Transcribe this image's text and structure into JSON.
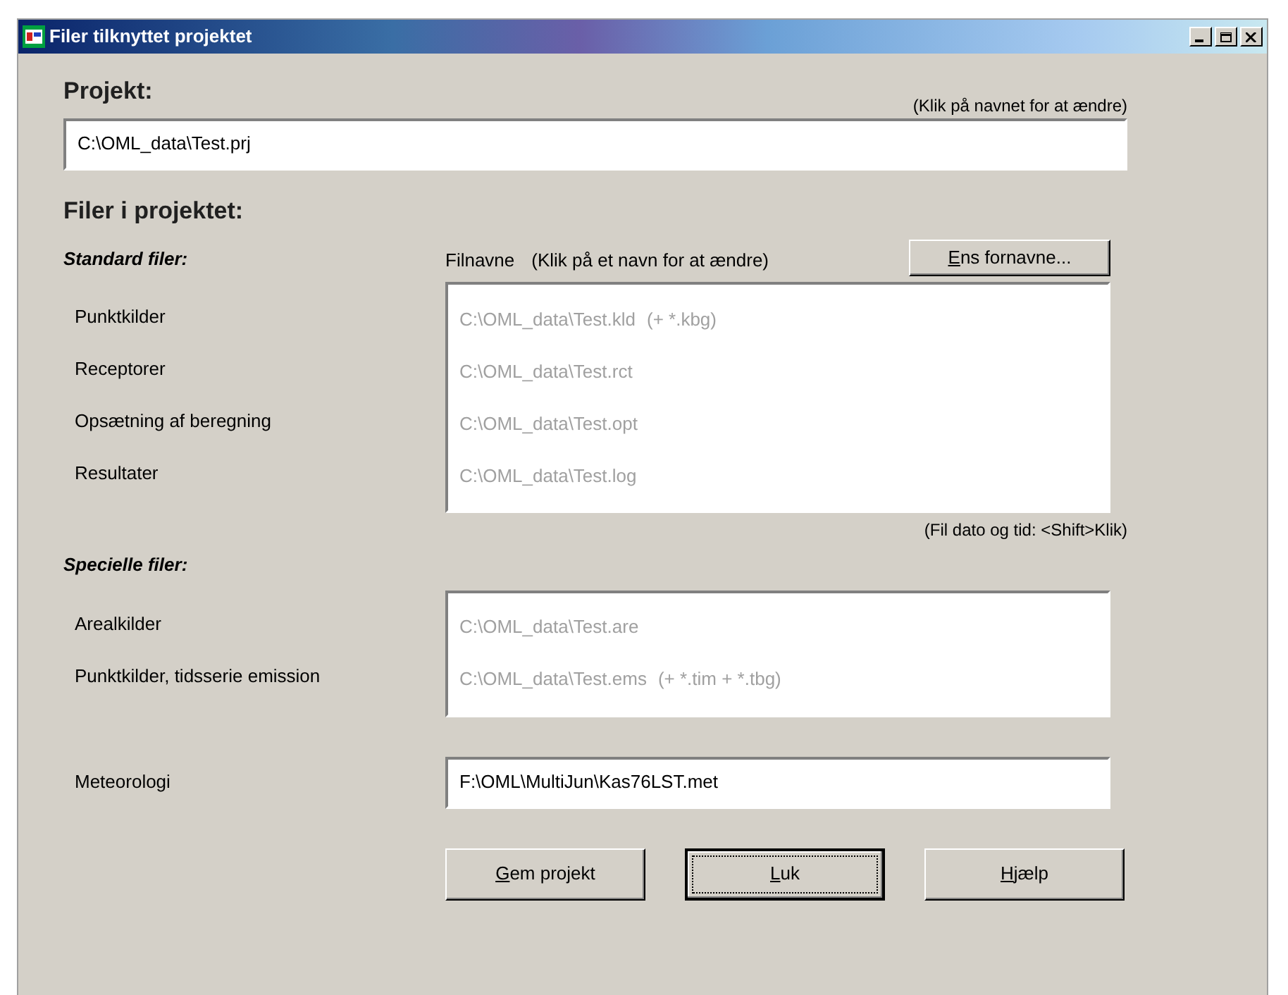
{
  "window": {
    "title": "Filer tilknyttet projektet"
  },
  "project": {
    "label": "Projekt:",
    "hint": "(Klik på navnet for at ændre)",
    "value": "C:\\OML_data\\Test.prj"
  },
  "files_heading": "Filer i projektet:",
  "standard": {
    "heading": "Standard filer:",
    "column_label": "Filnavne",
    "column_hint": "(Klik på et navn for at ændre)",
    "button": {
      "accel": "E",
      "rest": "ns fornavne..."
    },
    "disabled": true,
    "rows": [
      {
        "label": "Punktkilder",
        "file": "C:\\OML_data\\Test.kld",
        "extra": "(+ *.kbg)"
      },
      {
        "label": "Receptorer",
        "file": "C:\\OML_data\\Test.rct"
      },
      {
        "label": "Opsætning af beregning",
        "file": "C:\\OML_data\\Test.opt"
      },
      {
        "label": "Resultater",
        "file": "C:\\OML_data\\Test.log"
      }
    ],
    "footnote": "(Fil dato og tid: <Shift>Klik)"
  },
  "special": {
    "heading": "Specielle filer:",
    "disabled": true,
    "rows": [
      {
        "label": "Arealkilder",
        "file": "C:\\OML_data\\Test.are"
      },
      {
        "label": "Punktkilder, tidsserie emission",
        "file": "C:\\OML_data\\Test.ems",
        "extra": "(+ *.tim + *.tbg)"
      }
    ]
  },
  "meteorology": {
    "label": "Meteorologi",
    "value": "F:\\OML\\MultiJun\\Kas76LST.met"
  },
  "buttons": [
    {
      "accel": "G",
      "rest": "em projekt",
      "focused": false
    },
    {
      "accel": "L",
      "rest": "uk",
      "focused": true
    },
    {
      "accel": "H",
      "rest": "jælp",
      "focused": false
    }
  ]
}
